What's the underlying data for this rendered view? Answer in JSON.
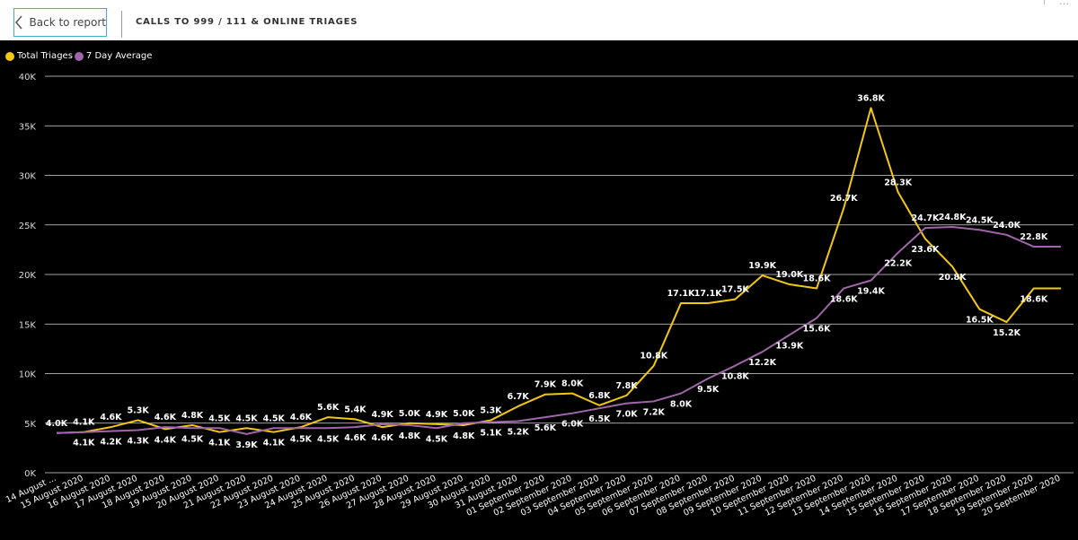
{
  "header": {
    "back_label": "Back to report",
    "title": "CALLS TO 999 / 111 & ONLINE TRIAGES",
    "corner_icons": "⊤ …"
  },
  "colors": {
    "total": "#f2c811",
    "average": "#a066aa",
    "grid": "#ffffff",
    "background": "#000000"
  },
  "chart_data": {
    "type": "line",
    "grid": true,
    "legend_position": "top-left",
    "ylim": [
      0,
      40000
    ],
    "y_ticks": [
      0,
      5000,
      10000,
      15000,
      20000,
      25000,
      30000,
      35000,
      40000
    ],
    "y_tick_labels": [
      "0K",
      "5K",
      "10K",
      "15K",
      "20K",
      "25K",
      "30K",
      "35K",
      "40K"
    ],
    "categories": [
      "14 August ...",
      "15 August 2020",
      "16 August 2020",
      "17 August 2020",
      "18 August 2020",
      "19 August 2020",
      "20 August 2020",
      "21 August 2020",
      "22 August 2020",
      "23 August 2020",
      "24 August 2020",
      "25 August 2020",
      "26 August 2020",
      "27 August 2020",
      "28 August 2020",
      "29 August 2020",
      "30 August 2020",
      "31 August 2020",
      "01 September 2020",
      "02 September 2020",
      "03 September 2020",
      "04 September 2020",
      "05 September 2020",
      "06 September 2020",
      "07 September 2020",
      "08 September 2020",
      "09 September 2020",
      "10 September 2020",
      "11 September 2020",
      "12 September 2020",
      "13 September 2020",
      "14 September 2020",
      "15 September 2020",
      "16 September 2020",
      "17 September 2020",
      "18 September 2020",
      "19 September 2020",
      "20 September 2020"
    ],
    "series": [
      {
        "name": "Total Triages",
        "values": [
          4000,
          4100,
          4600,
          5300,
          4400,
          4800,
          4100,
          4500,
          4100,
          4600,
          5600,
          5400,
          4600,
          5000,
          4900,
          4800,
          5300,
          6700,
          7900,
          8000,
          6800,
          7800,
          10800,
          17100,
          17100,
          17500,
          19900,
          19000,
          18600,
          26700,
          36800,
          28300,
          23600,
          20800,
          16500,
          15200,
          18600,
          18600
        ],
        "labels": [
          "4.0K",
          "4.1K",
          "4.6K",
          "5.3K",
          "4.4K",
          "4.8K",
          "4.1K",
          "4.5K",
          "4.1K",
          "4.6K",
          "5.6K",
          "5.4K",
          "4.6K",
          "5.0K",
          "4.9K",
          "4.8K",
          "5.3K",
          "6.7K",
          "7.9K",
          "8.0K",
          "6.8K",
          "7.8K",
          "10.8K",
          "17.1K",
          "17.1K",
          "17.5K",
          "19.9K",
          "19.0K",
          "18.6K",
          "26.7K",
          "36.8K",
          "28.3K",
          "23.6K",
          "20.8K",
          "16.5K",
          "15.2K",
          "18.6K",
          ""
        ]
      },
      {
        "name": "7 Day Average",
        "values": [
          4000,
          4100,
          4200,
          4300,
          4600,
          4500,
          4500,
          3900,
          4500,
          4500,
          4500,
          4600,
          4900,
          4800,
          4500,
          5000,
          5100,
          5200,
          5600,
          6000,
          6500,
          7000,
          7200,
          8000,
          9500,
          10800,
          12200,
          13900,
          15600,
          18600,
          19400,
          22200,
          24700,
          24800,
          24500,
          24000,
          22800,
          22800
        ],
        "labels": [
          "",
          "4.1K",
          "4.2K",
          "4.3K",
          "4.6K",
          "4.5K",
          "4.5K",
          "3.9K",
          "4.5K",
          "4.5K",
          "4.5K",
          "4.6K",
          "4.9K",
          "4.8K",
          "4.5K",
          "5.0K",
          "5.1K",
          "5.2K",
          "5.6K",
          "6.0K",
          "6.5K",
          "7.0K",
          "7.2K",
          "8.0K",
          "9.5K",
          "10.8K",
          "12.2K",
          "13.9K",
          "15.6K",
          "18.6K",
          "19.4K",
          "22.2K",
          "24.7K",
          "24.8K",
          "24.5K",
          "24.0K",
          "22.8K",
          ""
        ]
      }
    ]
  }
}
